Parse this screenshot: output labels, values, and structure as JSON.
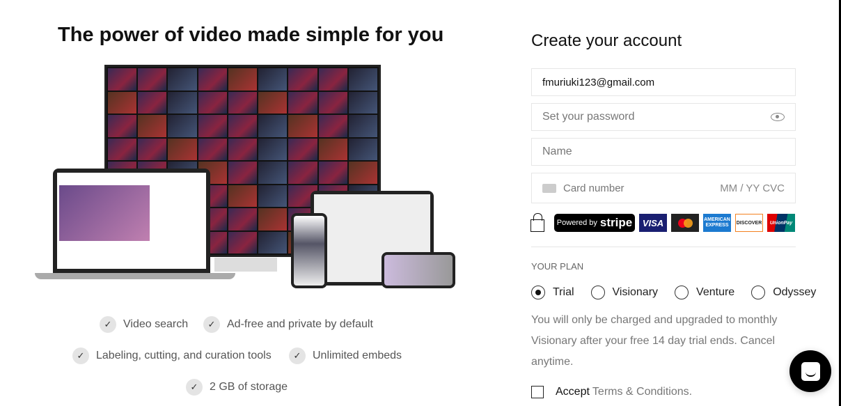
{
  "headline": "The power of video made simple for you",
  "features": [
    "Video search",
    "Ad-free and private by default",
    "Labeling, cutting, and curation tools",
    "Unlimited embeds",
    "2 GB of storage"
  ],
  "form": {
    "title": "Create your account",
    "email_value": "fmuriuki123@gmail.com",
    "password_placeholder": "Set your password",
    "name_placeholder": "Name",
    "card_placeholder": "Card number",
    "expiry_cvc": "MM / YY  CVC"
  },
  "badges": {
    "powered_by": "Powered by",
    "stripe": "stripe",
    "visa": "VISA",
    "amex": "AMERICAN EXPRESS",
    "discover": "DISCOVER",
    "unionpay": "UnionPay"
  },
  "plan": {
    "heading": "YOUR PLAN",
    "options": [
      "Trial",
      "Visionary",
      "Venture",
      "Odyssey"
    ],
    "selected": "Trial",
    "note": "You will only be charged and upgraded to monthly Visionary after your free 14 day trial ends. Cancel anytime."
  },
  "terms": {
    "accept": "Accept",
    "link": "Terms & Conditions."
  }
}
